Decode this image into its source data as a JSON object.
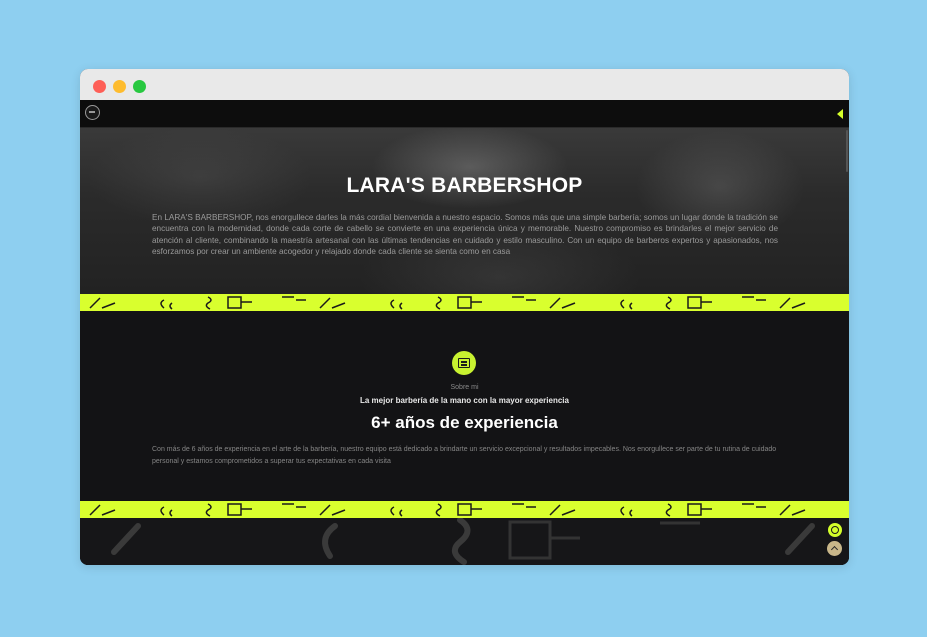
{
  "browser": {
    "buttons": [
      "close",
      "minimize",
      "maximize"
    ]
  },
  "navbar": {
    "logo_icon": "barber-logo-icon",
    "menu_icon": "menu-toggle-icon"
  },
  "hero": {
    "title": "LARA'S BARBERSHOP",
    "description": "En LARA'S BARBERSHOP, nos enorgullece darles la más cordial bienvenida a nuestro espacio. Somos más que una simple barbería; somos un lugar donde la tradición se encuentra con la modernidad, donde cada corte de cabello se convierte en una experiencia única y memorable. Nuestro compromiso es brindarles el mejor servicio de atención al cliente, combinando la maestría artesanal con las últimas tendencias en cuidado y estilo masculino. Con un equipo de barberos expertos y apasionados, nos esforzamos por crear un ambiente acogedor y relajado donde cada cliente se sienta como en casa"
  },
  "about": {
    "icon": "id-card-icon",
    "kicker": "Sobre mi",
    "subtitle": "La mejor barbería de la mano con la mayor experiencia",
    "title": "6+ años de experiencia",
    "description": "Con más de 6 años de experiencia en el arte de la barbería, nuestro equipo está dedicado a brindarte un servicio excepcional y resultados impecables. Nos enorgullece ser parte de tu rutina de cuidado personal y estamos comprometidos a superar tus expectativas en cada visita"
  },
  "floating": {
    "whatsapp_icon": "whatsapp-icon",
    "scroll_top_icon": "chevron-up-icon"
  },
  "colors": {
    "accent": "#d9ff2e",
    "background": "#131315",
    "scroll_top": "#c9b78a"
  }
}
